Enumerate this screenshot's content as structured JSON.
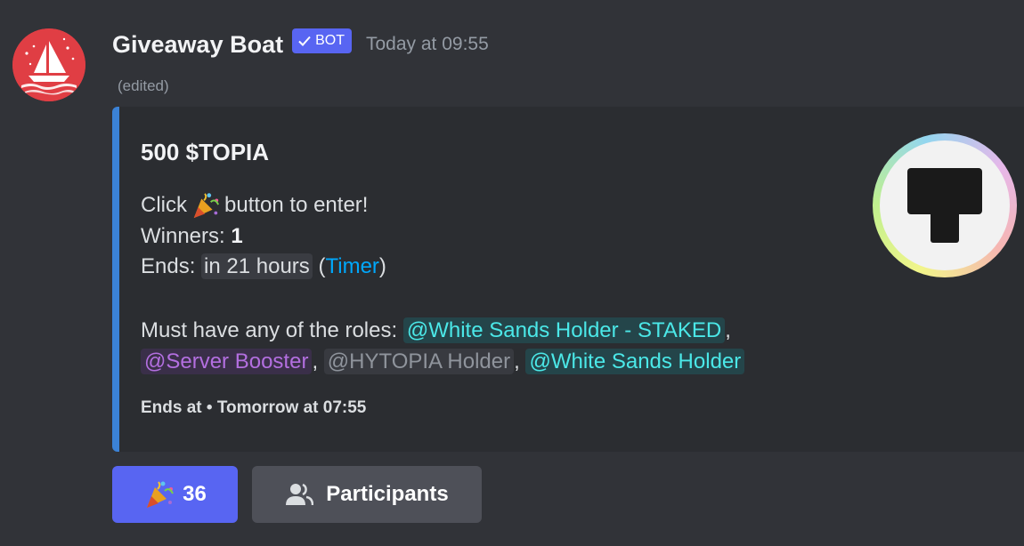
{
  "message": {
    "username": "Giveaway Boat",
    "bot_badge": "BOT",
    "timestamp": "Today at 09:55",
    "edited": "(edited)"
  },
  "embed": {
    "title": "500 $TOPIA",
    "click_prefix": "Click",
    "click_suffix": "button to enter!",
    "winners_label": "Winners:",
    "winners_value": "1",
    "ends_label": "Ends:",
    "ends_value": "in 21 hours",
    "timer_paren_open": "(",
    "timer_link": "Timer",
    "timer_paren_close": ")",
    "roles_prefix": "Must have any of the roles:",
    "roles": [
      "@White Sands Holder - STAKED",
      "@Server Booster",
      "@HYTOPIA Holder",
      "@White Sands Holder"
    ],
    "separator": ",",
    "footer": "Ends at • Tomorrow at 07:55",
    "accent_color": "#3b82d6"
  },
  "buttons": {
    "enter_count": "36",
    "participants_label": "Participants"
  },
  "icons": {
    "avatar": "sailboat-avatar-icon",
    "verified": "checkmark-icon",
    "party": "party-popper-icon",
    "thumbnail": "hytopia-logo-icon",
    "participants": "people-icon"
  }
}
